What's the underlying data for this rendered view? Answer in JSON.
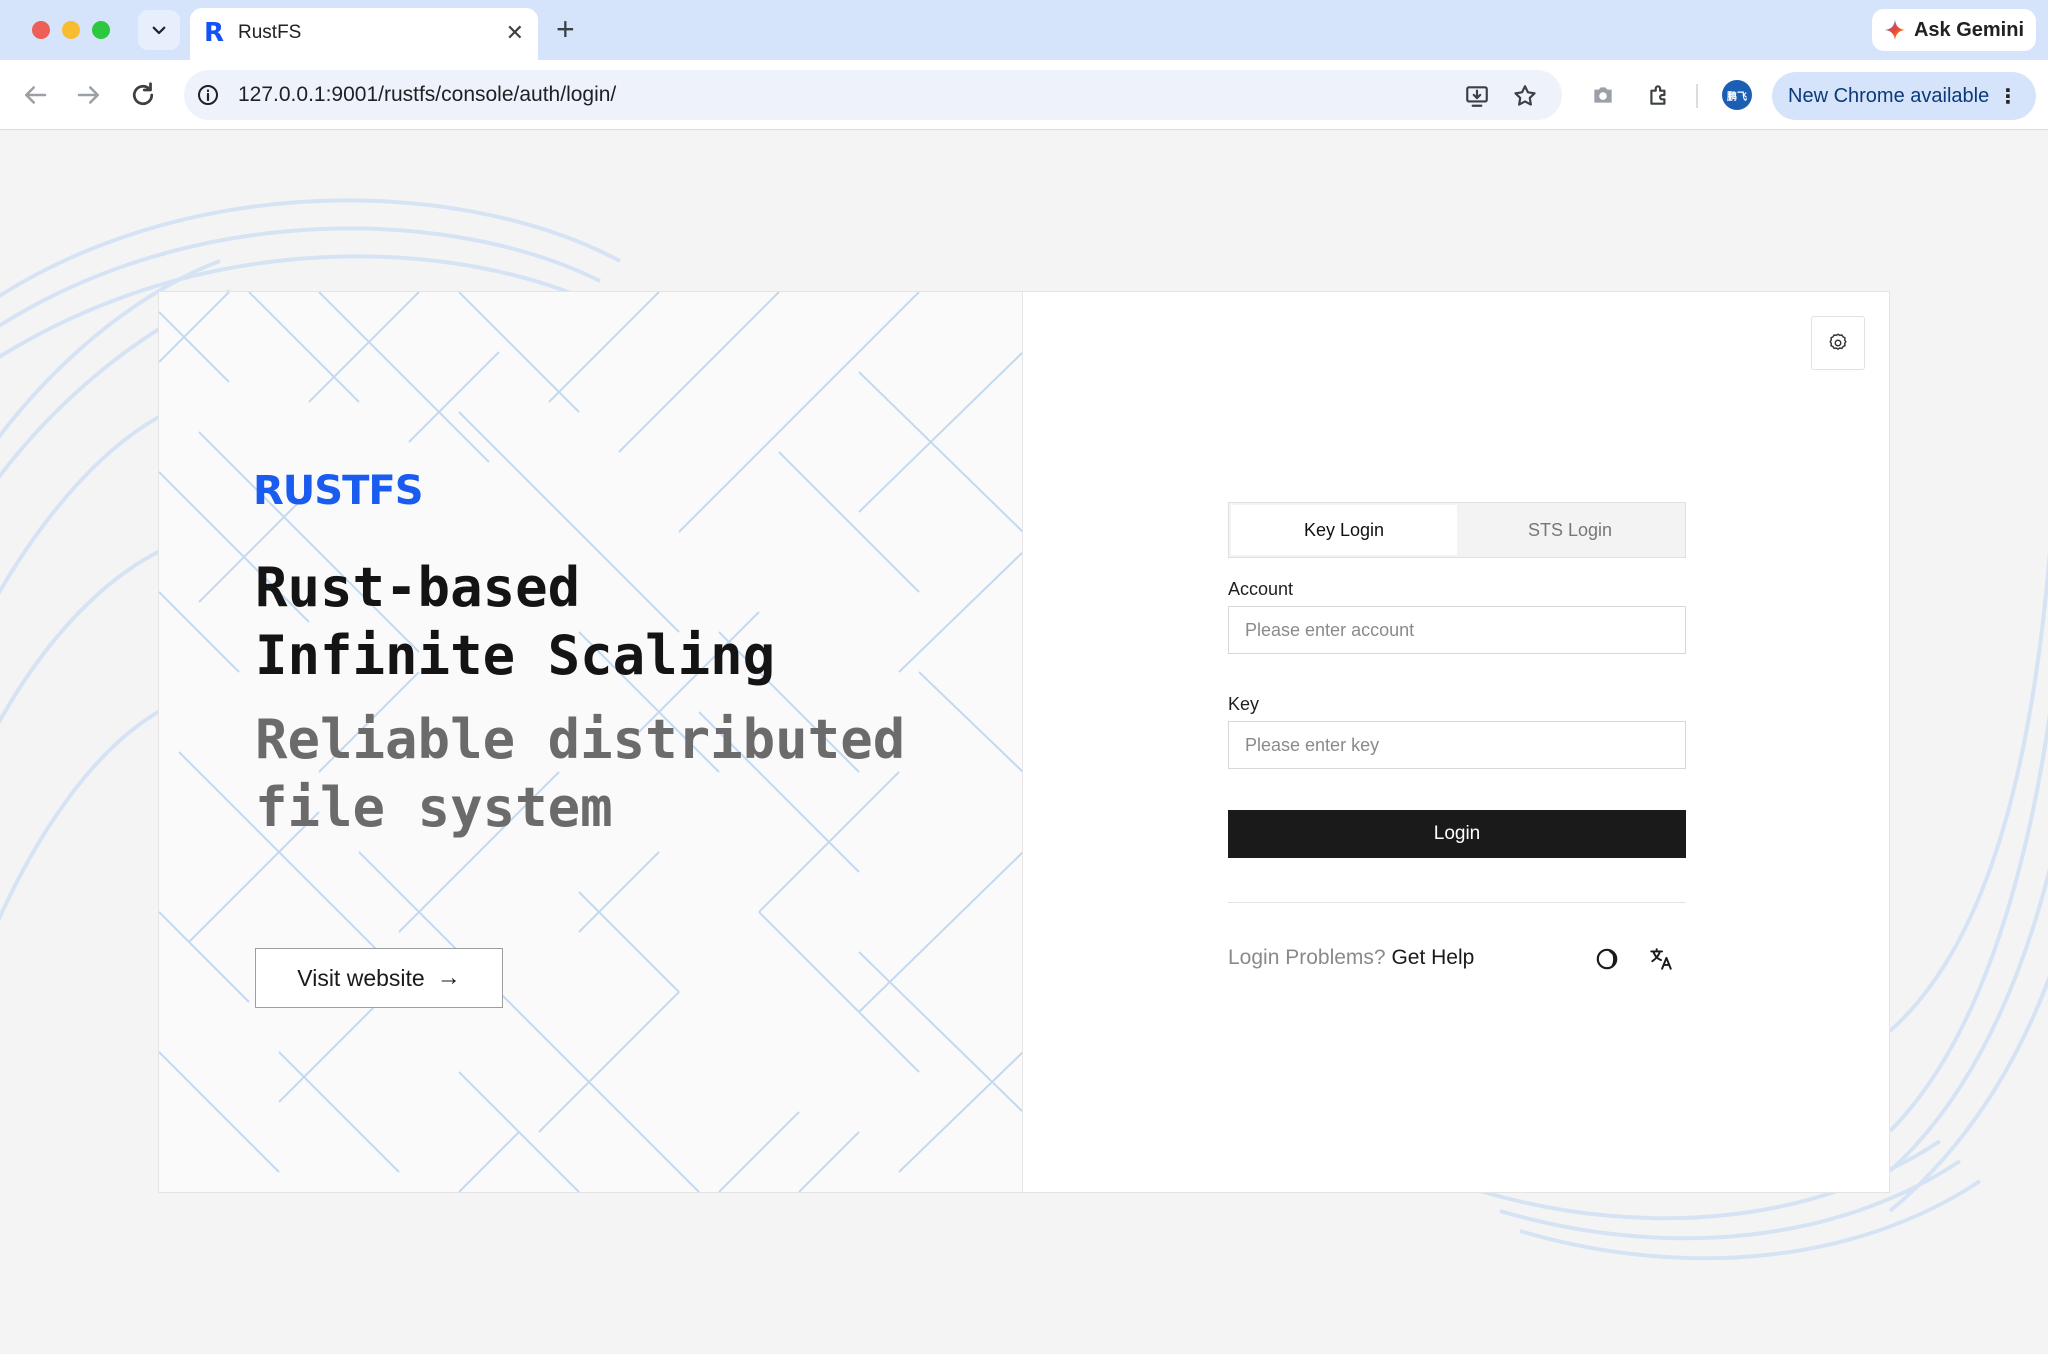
{
  "browser": {
    "tab_title": "RustFS",
    "tab_favicon": "R",
    "url": "127.0.0.1:9001/rustfs/console/auth/login/",
    "ask_gemini": "Ask Gemini",
    "update_label": "New Chrome available",
    "profile_initials": "鹏飞",
    "new_tab_glyph": "+",
    "close_glyph": "✕",
    "menu_glyph": "⋮"
  },
  "hero": {
    "logo": "RUSTFS",
    "headline_line1": "Rust-based",
    "headline_line2": "Infinite Scaling",
    "subline_line1": "Reliable distributed",
    "subline_line2": "file system",
    "visit_label": "Visit website",
    "visit_arrow": "→"
  },
  "login": {
    "tabs": [
      {
        "label": "Key Login",
        "active": true
      },
      {
        "label": "STS Login",
        "active": false
      }
    ],
    "account_label": "Account",
    "account_placeholder": "Please enter account",
    "key_label": "Key",
    "key_placeholder": "Please enter key",
    "submit_label": "Login",
    "help_prefix": "Login Problems?",
    "help_link": "Get Help"
  },
  "colors": {
    "brand_blue": "#1a5cf0",
    "button_dark": "#1a1a1a",
    "chrome_blue": "#d6e4fb"
  },
  "icons": [
    "chevron-down-icon",
    "close-icon",
    "plus-icon",
    "gemini-sparkle-icon",
    "back-icon",
    "forward-icon",
    "reload-icon",
    "info-icon",
    "install-icon",
    "star-icon",
    "camera-icon",
    "extensions-icon",
    "gear-icon",
    "theme-toggle-icon",
    "translate-icon"
  ]
}
